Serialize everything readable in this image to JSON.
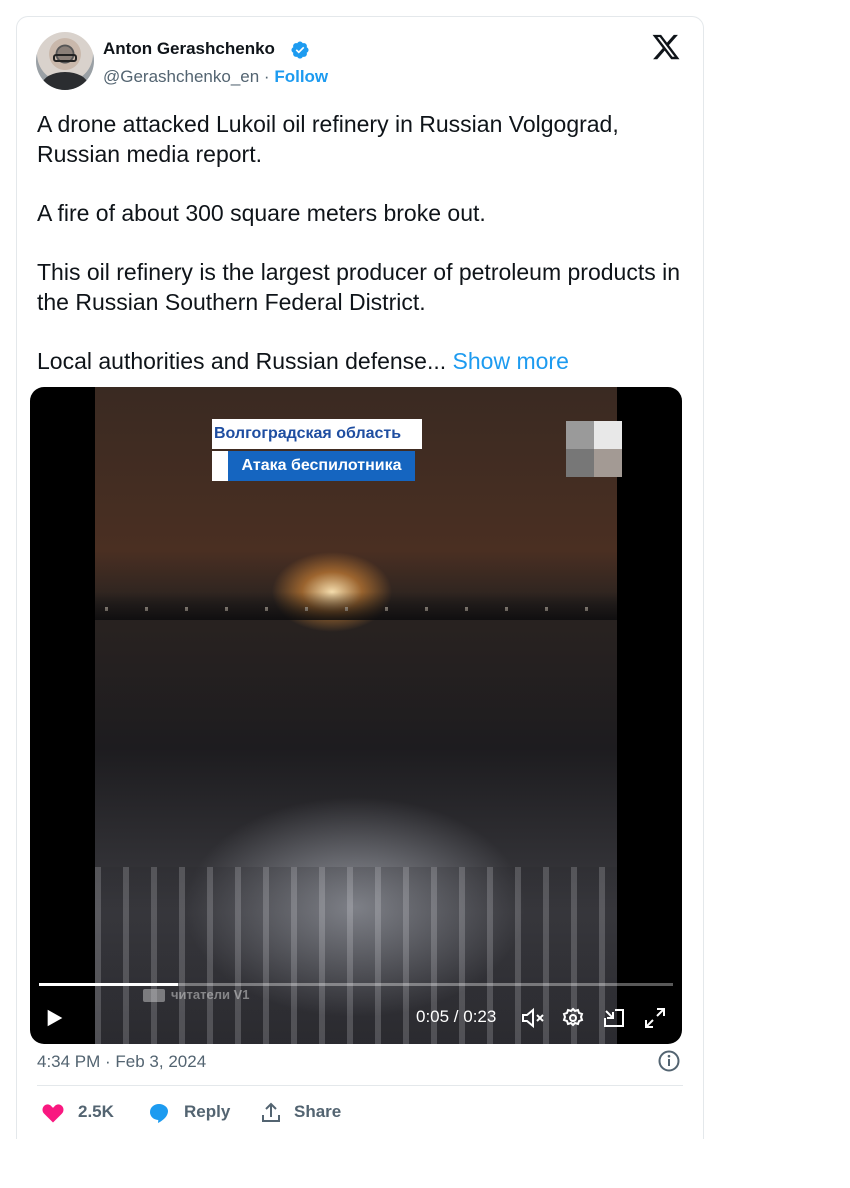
{
  "author": {
    "name": "Anton Gerashchenko",
    "handle": "@Gerashchenko_en",
    "separator": "·",
    "follow_label": "Follow",
    "verified_color": "#1d9bf0"
  },
  "tweet": {
    "paragraphs": [
      "A drone attacked Lukoil oil refinery in Russian Volgograd, Russian media report.",
      "A fire of about 300 square meters broke out.",
      "This oil refinery is the largest producer of petroleum products in the Russian Southern Federal District."
    ],
    "truncated_paragraph": "Local authorities and Russian defense...",
    "show_more_label": "Show more"
  },
  "video": {
    "caption_region": "Волгоградская область",
    "caption_event": "Атака беспилотника",
    "watermark": "читатели V1",
    "time_display": "0:05 / 0:23",
    "progress_fraction": 0.22
  },
  "footer": {
    "timestamp": "4:34 PM · Feb 3, 2024",
    "like_count": "2.5K",
    "reply_label": "Reply",
    "share_label": "Share"
  },
  "colors": {
    "accent": "#1d9bf0",
    "like": "#f91880",
    "muted": "#536471"
  },
  "icons": [
    "verified-badge-icon",
    "x-logo-icon",
    "play-icon",
    "mute-icon",
    "settings-icon",
    "dock-icon",
    "fullscreen-icon",
    "info-icon",
    "heart-icon",
    "reply-icon",
    "share-icon"
  ]
}
